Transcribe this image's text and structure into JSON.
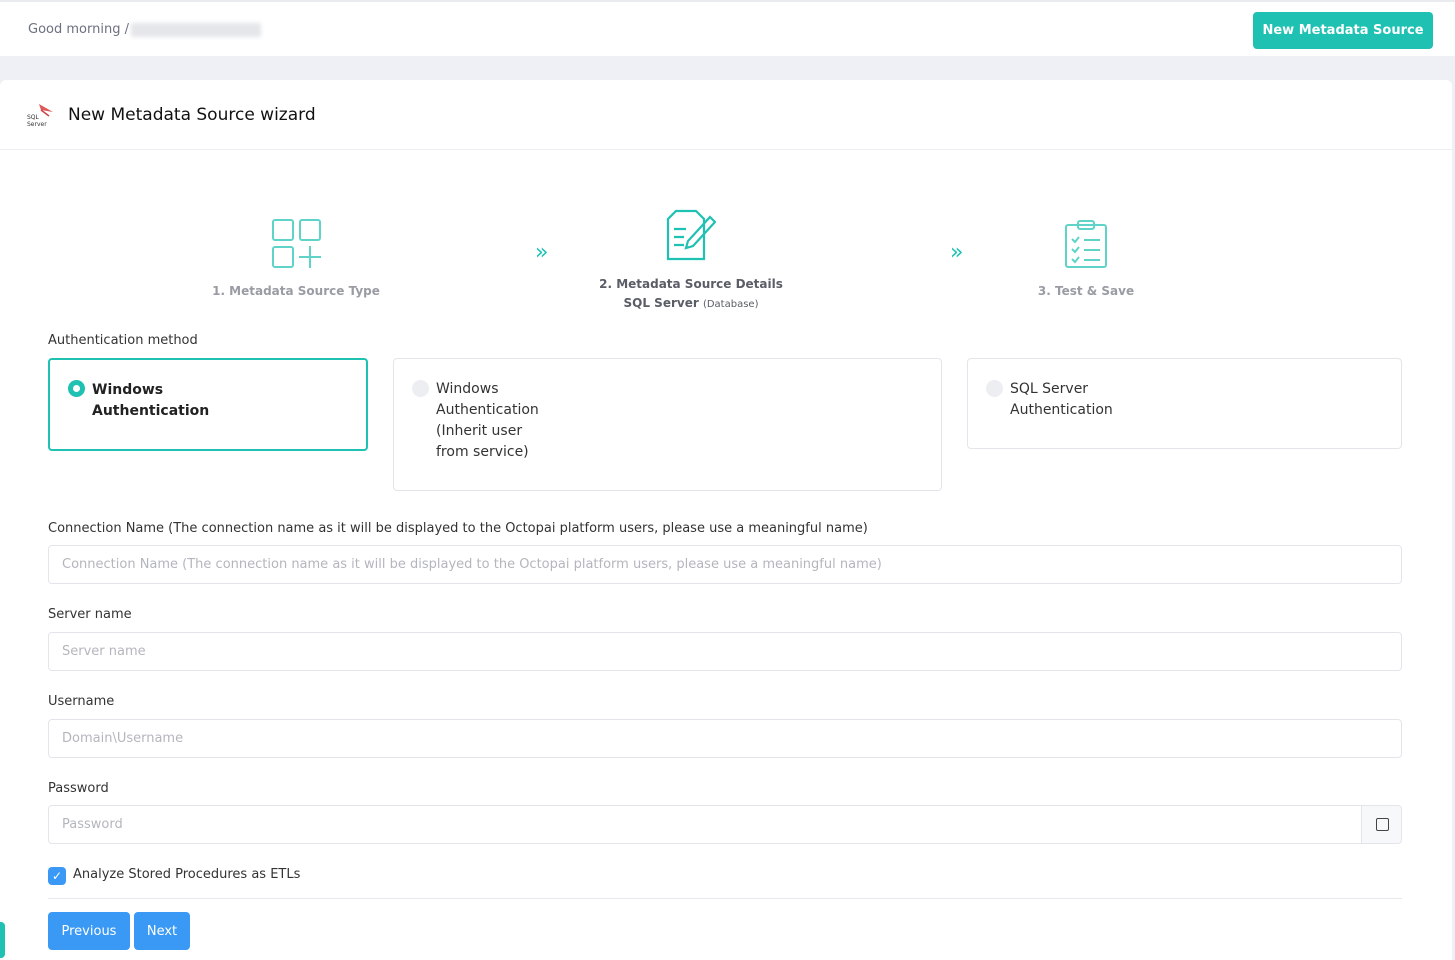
{
  "topbar": {
    "greeting": "Good morning /",
    "new_source_label": "New Metadata Source"
  },
  "wizard": {
    "title": "New Metadata Source wizard",
    "logo_text": "SQL Server"
  },
  "steps": [
    {
      "label": "1. Metadata Source Type",
      "icon": "grid-plus-icon"
    },
    {
      "label": "2. Metadata Source Details",
      "sub_bold": "SQL Server",
      "sub": "(Database)",
      "icon": "edit-document-icon"
    },
    {
      "label": "3. Test & Save",
      "icon": "checklist-icon"
    }
  ],
  "auth": {
    "label": "Authentication method",
    "options": [
      {
        "label": "Windows Authentication",
        "selected": true
      },
      {
        "label": "Windows Authentication (Inherit user from service)",
        "selected": false
      },
      {
        "label": "SQL Server Authentication",
        "selected": false
      }
    ]
  },
  "fields": {
    "connection": {
      "label": "Connection Name (The connection name as it will be displayed to the Octopai platform users, please use a meaningful name)",
      "placeholder": "Connection Name (The connection name as it will be displayed to the Octopai platform users, please use a meaningful name)"
    },
    "server": {
      "label": "Server name",
      "placeholder": "Server name"
    },
    "username": {
      "label": "Username",
      "placeholder": "Domain\\Username"
    },
    "password": {
      "label": "Password",
      "placeholder": "Password"
    }
  },
  "analyze": {
    "label": "Analyze Stored Procedures as ETLs",
    "checked": true
  },
  "buttons": {
    "previous": "Previous",
    "next": "Next"
  },
  "colors": {
    "accent": "#1fc1b3",
    "primary": "#3a99f5"
  }
}
